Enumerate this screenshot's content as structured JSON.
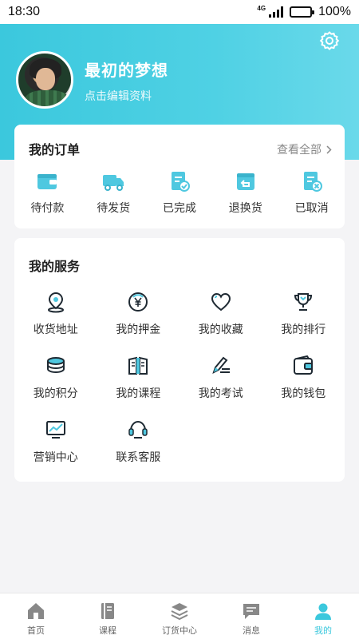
{
  "status_bar": {
    "time": "18:30",
    "network": "4G",
    "battery": "100%"
  },
  "profile": {
    "username": "最初的梦想",
    "edit_hint": "点击编辑资料"
  },
  "orders": {
    "title": "我的订单",
    "view_all": "查看全部",
    "items": [
      {
        "label": "待付款",
        "icon": "wallet-icon"
      },
      {
        "label": "待发货",
        "icon": "truck-icon"
      },
      {
        "label": "已完成",
        "icon": "completed-doc-icon"
      },
      {
        "label": "退换货",
        "icon": "return-box-icon"
      },
      {
        "label": "已取消",
        "icon": "cancelled-doc-icon"
      }
    ]
  },
  "services": {
    "title": "我的服务",
    "items": [
      {
        "label": "收货地址",
        "icon": "location-icon"
      },
      {
        "label": "我的押金",
        "icon": "yuan-coin-icon"
      },
      {
        "label": "我的收藏",
        "icon": "heart-icon"
      },
      {
        "label": "我的排行",
        "icon": "trophy-icon"
      },
      {
        "label": "我的积分",
        "icon": "coins-stack-icon"
      },
      {
        "label": "我的课程",
        "icon": "book-icon"
      },
      {
        "label": "我的考试",
        "icon": "pen-icon"
      },
      {
        "label": "我的钱包",
        "icon": "wallet-icon"
      },
      {
        "label": "营销中心",
        "icon": "chart-monitor-icon"
      },
      {
        "label": "联系客服",
        "icon": "headset-icon"
      }
    ]
  },
  "tabbar": {
    "items": [
      {
        "label": "首页",
        "icon": "home-icon"
      },
      {
        "label": "课程",
        "icon": "course-icon"
      },
      {
        "label": "订货中心",
        "icon": "layers-icon"
      },
      {
        "label": "消息",
        "icon": "message-icon"
      },
      {
        "label": "我的",
        "icon": "user-icon"
      }
    ],
    "active_index": 4
  },
  "colors": {
    "accent": "#3bc8dd",
    "icon_dark": "#1f2a33",
    "icon_blue": "#4fc8e0"
  }
}
